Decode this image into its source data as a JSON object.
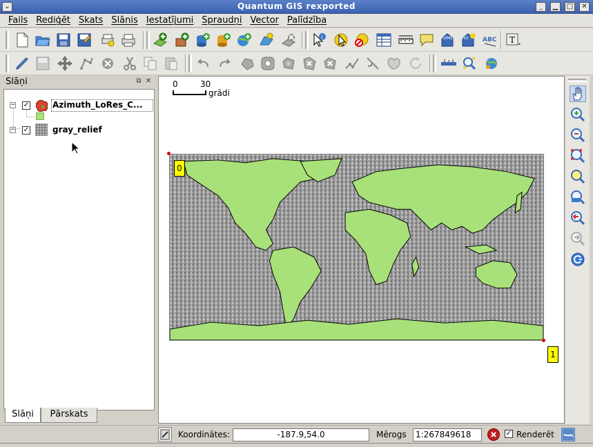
{
  "window": {
    "title": "Quantum GIS rexported"
  },
  "menu": {
    "items": [
      "Fails",
      "Rediģēt",
      "Skats",
      "Slānis",
      "Iestatījumi",
      "Spraudņi",
      "Vector",
      "Palīdzība"
    ]
  },
  "legend": {
    "header": "Slāņi",
    "layers": [
      {
        "name": "Azimuth_LoRes_C...",
        "checked": true
      },
      {
        "name": "gray_relief",
        "checked": true
      }
    ],
    "tabs": [
      "Slāņi",
      "Pārskats"
    ]
  },
  "map": {
    "scalebar": {
      "start": "0",
      "end": "30",
      "unit": "grādi"
    },
    "corner_labels": [
      "0",
      "1"
    ],
    "colors": {
      "land": "#a8e07a",
      "relief": "#9a9a9a",
      "label_bg": "#ffff00"
    }
  },
  "statusbar": {
    "coord_label": "Koordinātes:",
    "coord_value": "-187.9,54.0",
    "scale_label": "Mērogs",
    "scale_value": "1:267849618",
    "render_label": "Renderēt",
    "render_checked": true
  }
}
